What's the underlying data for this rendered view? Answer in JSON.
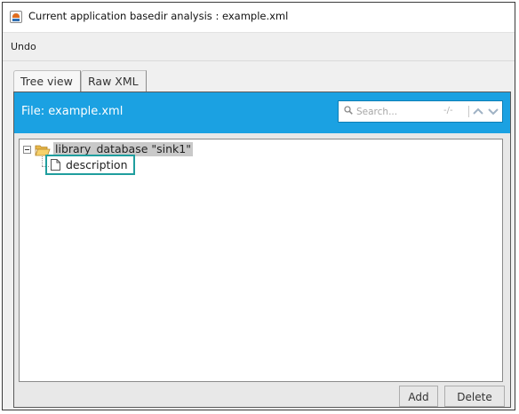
{
  "window": {
    "title": "Current application basedir analysis : example.xml"
  },
  "menu": {
    "undo_label": "Undo"
  },
  "tabs": [
    {
      "label": "Tree view",
      "selected": true
    },
    {
      "label": "Raw XML",
      "selected": false
    }
  ],
  "header": {
    "file_label": "File: example.xml",
    "accent_color": "#1ba1e2",
    "search": {
      "placeholder": "Search...",
      "match_count": "-/-",
      "icon": "search-icon",
      "prev_icon": "chevron-up-icon",
      "next_icon": "chevron-down-icon"
    }
  },
  "tree": {
    "root": {
      "label": "library_database \"sink1\"",
      "icon": "folder-open-icon",
      "expanded": true,
      "selected": true
    },
    "children": [
      {
        "label": "description",
        "icon": "file-icon",
        "focused": true
      }
    ]
  },
  "buttons": {
    "add_label": "Add",
    "delete_label": "Delete"
  }
}
